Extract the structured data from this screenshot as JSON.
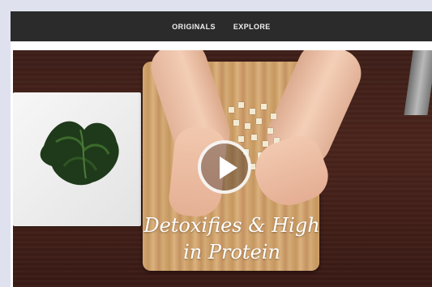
{
  "nav": {
    "items": [
      {
        "label": "ORIGINALS"
      },
      {
        "label": "EXPLORE"
      }
    ]
  },
  "video": {
    "caption_line1": "Detoxifies & High",
    "caption_line2": "in Protein",
    "play_icon": "play-icon"
  },
  "colors": {
    "page_bg": "#dfe2ee",
    "nav_bg": "#2b2b2b",
    "nav_text": "#f0f0f0",
    "table_wood": "#4a241c",
    "board_wood": "#d3a873"
  }
}
